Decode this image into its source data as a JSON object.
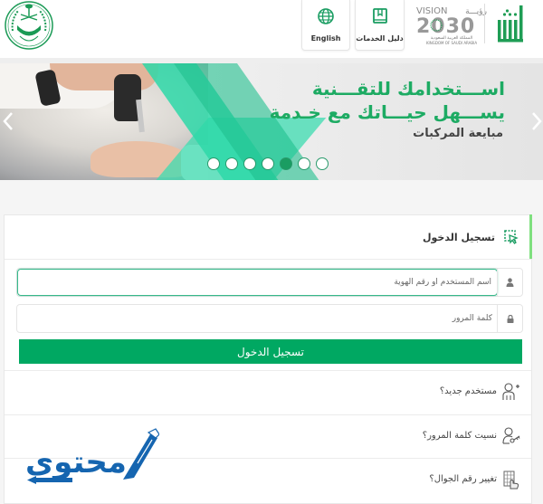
{
  "header": {
    "english_label": "English",
    "guide_label": "دليل الخدمات",
    "vision_text": "VISION",
    "vision_arabic": "رؤيـــة",
    "vision_year": "2030",
    "vision_sub_ar": "المملكة العربية السعودية",
    "vision_sub_en": "KINGDOM OF SAUDI ARABIA",
    "absher_logo": "أبشر"
  },
  "banner": {
    "line1": "اســـتخدامك للتقـــنية",
    "line2": "يســـهل حيـــاتك مع خـدمة",
    "subtitle": "مبايعة المركبات",
    "slide_count": 7,
    "active_slide": 5
  },
  "login": {
    "title": "تسجيل الدخول",
    "username_placeholder": "اسم المستخدم أو رقم الهوية",
    "username_value": "",
    "password_placeholder": "كلمة المرور",
    "password_value": "",
    "submit_label": "تسجيل الدخول"
  },
  "links": [
    {
      "label": "مستخدم جديد؟",
      "icon": "add-user-icon"
    },
    {
      "label": "نسيت كلمة المرور؟",
      "icon": "user-key-icon"
    },
    {
      "label": "تغيير رقم الجوال؟",
      "icon": "mobile-keypad-icon"
    }
  ],
  "colors": {
    "brand_green": "#00a862",
    "banner_green": "#1dab63",
    "accent_teal": "#2ed8a8",
    "watermark_blue": "#1565b0"
  },
  "watermark": {
    "text": "محتوى"
  }
}
